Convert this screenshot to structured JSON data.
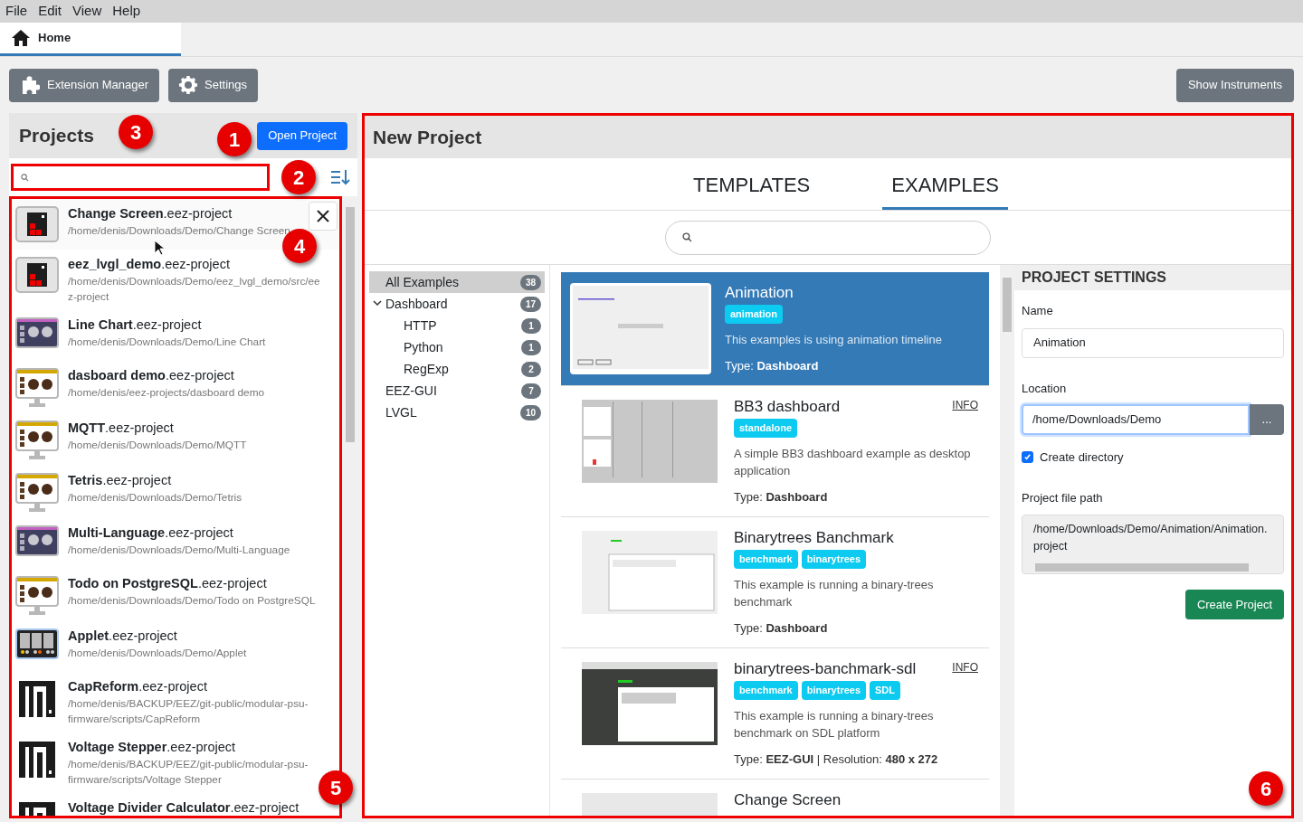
{
  "menu": [
    "File",
    "Edit",
    "View",
    "Help"
  ],
  "tabs": [
    {
      "label": "Home",
      "selected": true
    }
  ],
  "toolbar": {
    "left": [
      "Extension Manager",
      "Settings"
    ],
    "right": "Show Instruments"
  },
  "projects": {
    "title": "Projects",
    "open_button": "Open Project",
    "items": [
      {
        "name": "**Change Screen**.eez-project",
        "path": "/home/denis/Downloads/Demo/Change Screen",
        "kind": "app",
        "hovered": true
      },
      {
        "name": "**eez_lvgl_demo**.eez-project",
        "path": "/home/denis/Downloads/Demo/eez_lvgl_demo/src/eez-project",
        "kind": "app",
        "hovered": false
      },
      {
        "name": "**Line Chart**.eez-project",
        "path": "/home/denis/Downloads/Demo/Line Chart",
        "kind": "lvgl",
        "hovered": false
      },
      {
        "name": "**dasboard demo**.eez-project",
        "path": "/home/denis/eez-projects/dasboard demo",
        "kind": "monitor",
        "hovered": false
      },
      {
        "name": "**MQTT**.eez-project",
        "path": "/home/denis/Downloads/Demo/MQTT",
        "kind": "monitor",
        "hovered": false
      },
      {
        "name": "**Tetris**.eez-project",
        "path": "/home/denis/Downloads/Demo/Tetris",
        "kind": "monitor",
        "hovered": false
      },
      {
        "name": "**Multi-Language**.eez-project",
        "path": "/home/denis/Downloads/Demo/Multi-Language",
        "kind": "lvgl",
        "hovered": false
      },
      {
        "name": "**Todo on PostgreSQL**.eez-project",
        "path": "/home/denis/Downloads/Demo/Todo on PostgreSQL",
        "kind": "monitor",
        "hovered": false
      },
      {
        "name": "**Applet**.eez-project",
        "path": "/home/denis/Downloads/Demo/Applet",
        "kind": "applet",
        "hovered": false
      },
      {
        "name": "**CapReform**.eez-project",
        "path": "/home/denis/BACKUP/EEZ/git-public/modular-psu-firmware/scripts/CapReform",
        "kind": "modular",
        "hovered": false
      },
      {
        "name": "**Voltage Stepper**.eez-project",
        "path": "/home/denis/BACKUP/EEZ/git-public/modular-psu-firmware/scripts/Voltage Stepper",
        "kind": "modular",
        "hovered": false
      },
      {
        "name": "**Voltage Divider Calculator**.eez-project",
        "kind": "modular",
        "hovered": false
      }
    ]
  },
  "new_project": {
    "title": "New Project",
    "tabs": [
      {
        "label": "TEMPLATES",
        "selected": false
      },
      {
        "label": "EXAMPLES",
        "selected": true
      }
    ],
    "tree": [
      {
        "label": "All Examples",
        "count": "38",
        "selected": true
      },
      {
        "label": "Dashboard",
        "count": "17",
        "selected": false,
        "expanded": true,
        "children": [
          {
            "label": "HTTP",
            "count": "1",
            "selected": false
          },
          {
            "label": "Python",
            "count": "1",
            "selected": false
          },
          {
            "label": "RegExp",
            "count": "2",
            "selected": false
          }
        ]
      },
      {
        "label": "EEZ-GUI",
        "count": "7",
        "selected": false
      },
      {
        "label": "LVGL",
        "count": "10",
        "selected": false
      }
    ],
    "examples": [
      {
        "title": "Animation",
        "tags": [
          "animation"
        ],
        "description": "This examples is using animation timeline",
        "type": "Type: **Dashboard**",
        "selected": true
      },
      {
        "title": "BB3 dashboard",
        "info": "INFO",
        "tags": [
          "standalone"
        ],
        "description": "A simple BB3 dashboard example as desktop application",
        "type": "Type: **Dashboard**",
        "selected": false
      },
      {
        "title": "Binarytrees Banchmark",
        "tags": [
          "benchmark",
          "binarytrees"
        ],
        "description": "This example is running a binary-trees benchmark",
        "type": "Type: **Dashboard**",
        "selected": false
      },
      {
        "title": "binarytrees-banchmark-sdl",
        "info": "INFO",
        "tags": [
          "benchmark",
          "binarytrees",
          "SDL"
        ],
        "description": "This example is running a binary-trees benchmark on SDL platform",
        "type": "Type: **EEZ-GUI** | Resolution: **480 x 272**",
        "selected": false
      },
      {
        "title": "Change Screen",
        "selected": false
      }
    ],
    "settings": {
      "title": "PROJECT SETTINGS",
      "name_label": "Name",
      "name": "Animation",
      "location_label": "Location",
      "location": "/home/Downloads/Demo",
      "browse": "...",
      "create_directory": {
        "label": "Create directory",
        "checked": true
      },
      "path_label": "Project file path",
      "path_lines": [
        "/home/Downloads/Demo/Animation/Animation.",
        "project"
      ],
      "create_button": "Create Project"
    }
  },
  "callouts": [
    "1",
    "2",
    "3",
    "4",
    "5",
    "6"
  ]
}
